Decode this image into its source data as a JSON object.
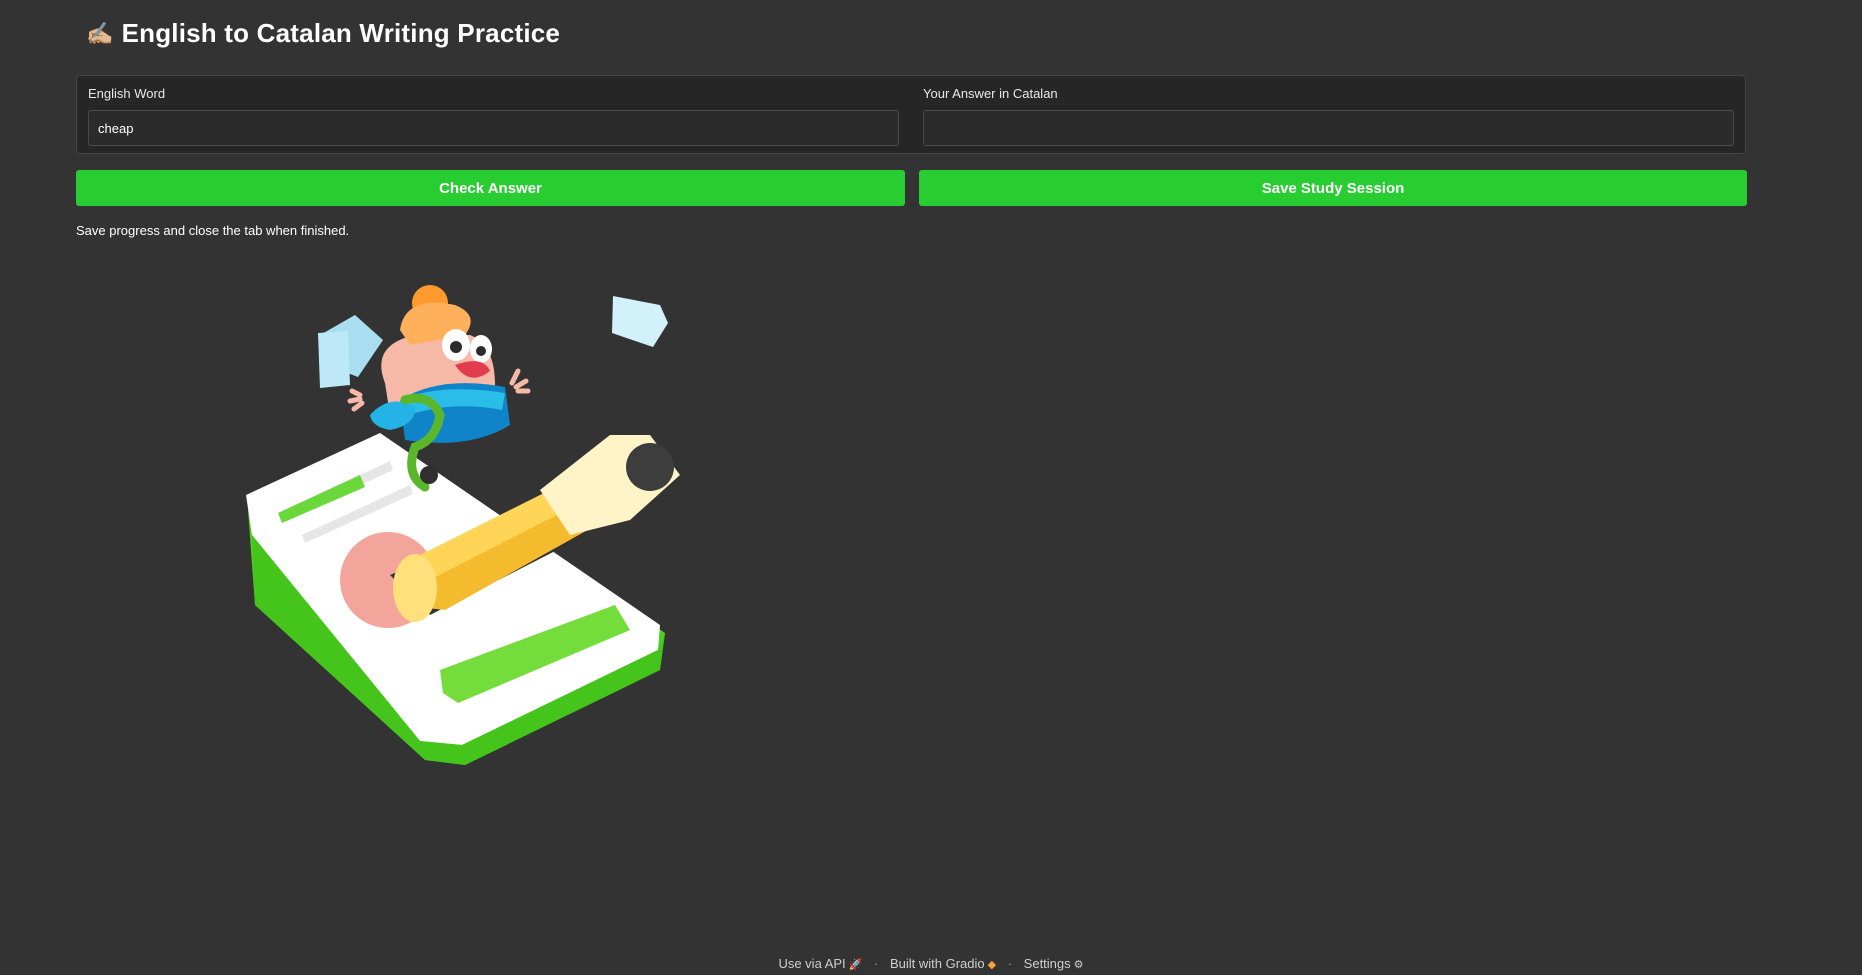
{
  "header": {
    "title_emoji": "✍🏼",
    "title": "English to Catalan Writing Practice"
  },
  "form": {
    "english_word_label": "English Word",
    "english_word_value": "cheap",
    "answer_label": "Your Answer in Catalan",
    "answer_value": "",
    "answer_placeholder": ""
  },
  "buttons": {
    "check_label": "Check Answer",
    "save_label": "Save Study Session"
  },
  "status": {
    "message": "Save progress and close the tab when finished."
  },
  "illustration": {
    "icon": "character-riding-pencil-illustration"
  },
  "footer": {
    "api_label": "Use via API",
    "api_icon": "rocket-icon",
    "built_label": "Built with Gradio",
    "built_icon": "gradio-logo-icon",
    "settings_label": "Settings",
    "settings_icon": "gear-icon"
  },
  "colors": {
    "background": "#333333",
    "panel": "#262626",
    "accent_button": "#28cd32"
  }
}
